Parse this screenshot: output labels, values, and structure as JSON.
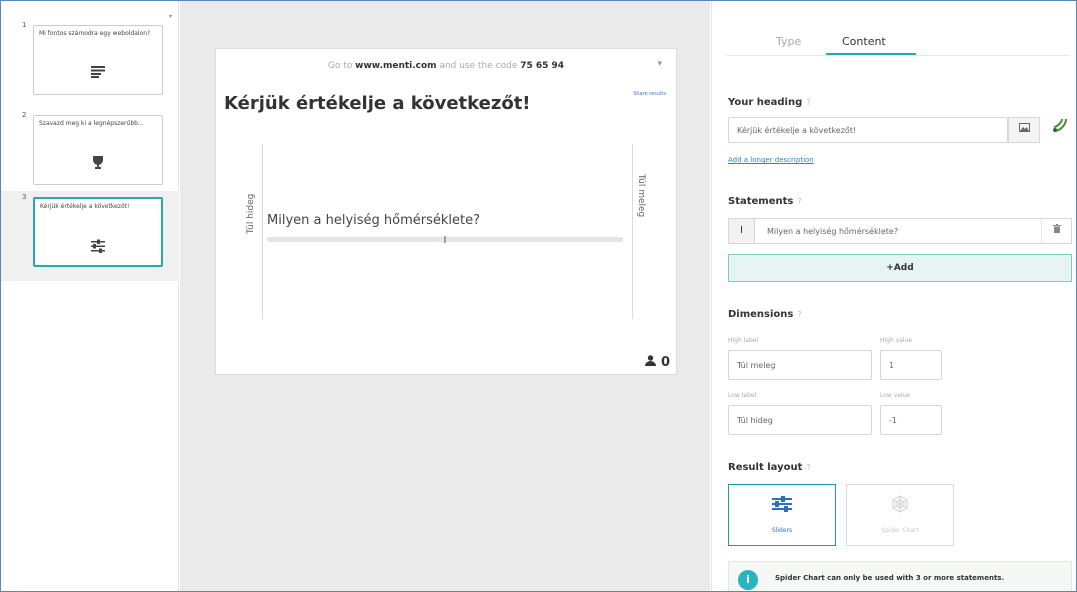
{
  "slides": [
    {
      "number": "1",
      "title": "Mi fontos számodra egy weboldalon?",
      "icon": "lines-icon"
    },
    {
      "number": "2",
      "title": "Szavazd meg ki a legnépszerűbb...",
      "icon": "trophy-icon"
    },
    {
      "number": "3",
      "title": "Kérjük értékelje a következőt!",
      "icon": "sliders-icon",
      "active": true
    }
  ],
  "preview": {
    "instruction_prefix": "Go to",
    "instruction_site": "www.menti.com",
    "instruction_middle": "and use the code",
    "instruction_code": "75 65 94",
    "heading": "Kérjük értékelje a következőt!",
    "share_label": "Share results",
    "low_label": "Túl hideg",
    "high_label": "Túl meleg",
    "statement": "Milyen a helyiség hőmérséklete?",
    "slider_position": 0.5,
    "responses": "0"
  },
  "editor": {
    "tabs": [
      "Type",
      "Content"
    ],
    "active_tab": "Content",
    "heading_label": "Your heading",
    "heading_value": "Kérjük értékelje a következőt!",
    "add_description": "Add a longer description",
    "statements_label": "Statements",
    "statements": [
      "Milyen a helyiség hőmérséklete?"
    ],
    "add_label": "+Add",
    "dimensions_label": "Dimensions",
    "high_label_caption": "High label",
    "high_label_value": "Túl meleg",
    "high_value_caption": "High value",
    "high_value": "1",
    "low_label_caption": "Low label",
    "low_label_value": "Túl hideg",
    "low_value_caption": "Low value",
    "low_value": "-1",
    "result_layout_label": "Result layout",
    "layouts": [
      {
        "label": "Sliders",
        "selected": true
      },
      {
        "label": "Spider Chart",
        "selected": false
      }
    ],
    "info_text": "Spider Chart can only be used with 3 or more statements."
  },
  "colors": {
    "accent": "#2aa9ad",
    "link": "#2a86c5",
    "selected_layout": "#2b6fc0"
  }
}
